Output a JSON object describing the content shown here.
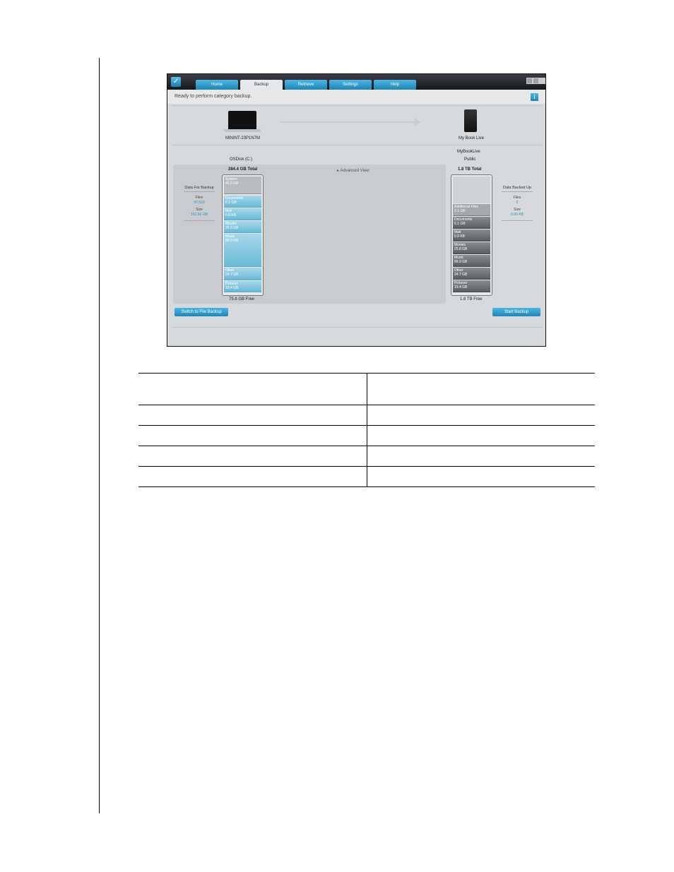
{
  "app": {
    "tabs": [
      {
        "label": "Home",
        "active": false
      },
      {
        "label": "Backup",
        "active": true
      },
      {
        "label": "Retrieve",
        "active": false
      },
      {
        "label": "Settings",
        "active": false
      },
      {
        "label": "Help",
        "active": false
      }
    ],
    "status": "Ready to perform category backup.",
    "source_computer": "MININT-23P1N7M",
    "target_device": "My Book Live",
    "left": {
      "disk": "OSDisk (C:)",
      "total": "284.4 GB Total",
      "free": "75.8 GB Free",
      "segments": [
        {
          "name": "System",
          "size": "45.6 GB"
        },
        {
          "name": "Documents",
          "size": "6.1 GB"
        },
        {
          "name": "Mail",
          "size": "0.9 KB"
        },
        {
          "name": "Movies",
          "size": "25.8 GB"
        },
        {
          "name": "Music",
          "size": "86.9 GB"
        },
        {
          "name": "Other",
          "size": "24.7 GB"
        },
        {
          "name": "Pictures",
          "size": "19.4 GB"
        }
      ],
      "summary": {
        "title": "Data For Backup",
        "files_label": "Files",
        "files_value": "47,923",
        "size_label": "Size",
        "size_value": "161.66 GB"
      }
    },
    "right": {
      "device": "MyBookLive",
      "share": "Public",
      "total": "1.8 TB Total",
      "free": "1.8 TB Free",
      "segments": [
        {
          "name": "Additional Files",
          "size": "2.1 GB"
        },
        {
          "name": "Documents",
          "size": "6.1 GB"
        },
        {
          "name": "Mail",
          "size": "0.9 KB"
        },
        {
          "name": "Movies",
          "size": "25.8 GB"
        },
        {
          "name": "Music",
          "size": "86.9 GB"
        },
        {
          "name": "Other",
          "size": "24.7 GB"
        },
        {
          "name": "Pictures",
          "size": "19.4 GB"
        }
      ],
      "summary": {
        "title": "Data Backed Up",
        "files_label": "Files",
        "files_value": "0",
        "size_label": "Size",
        "size_value": "0.00 KB"
      }
    },
    "advanced_view": "Advanced View",
    "switch_button": "Switch to File Backup",
    "start_button": "Start Backup"
  },
  "table": {
    "rows": [
      [
        "",
        ""
      ],
      [
        "",
        ""
      ],
      [
        "",
        ""
      ],
      [
        "",
        ""
      ],
      [
        "",
        ""
      ]
    ]
  }
}
